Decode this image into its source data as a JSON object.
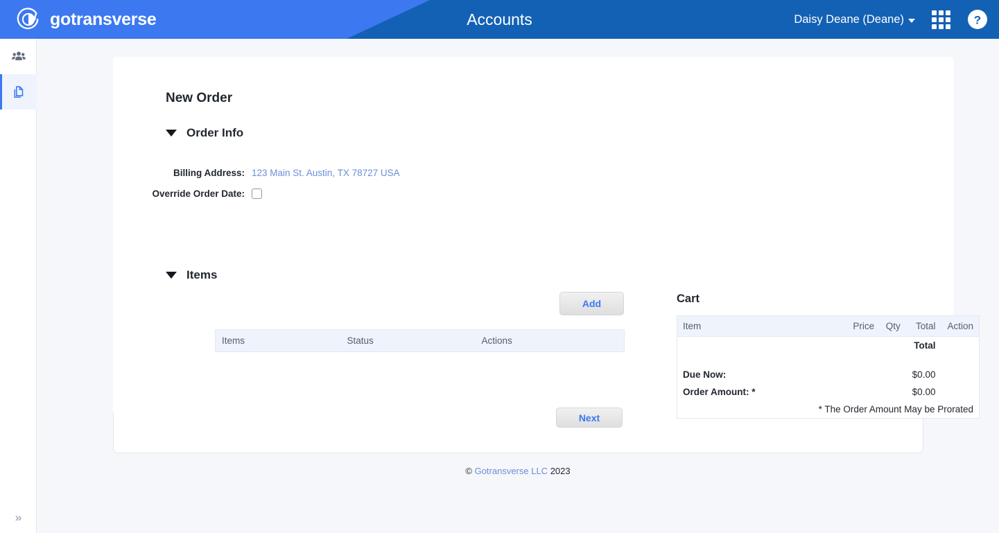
{
  "header": {
    "brand": "gotransverse",
    "brand_logo_icon": "gotransverse-circle-logo",
    "title": "Accounts",
    "user_menu": "Daisy Deane (Deane)",
    "apps_icon": "grid-apps-icon",
    "help_icon": "help-question-icon",
    "caret_icon": "chevron-down-icon",
    "wedge_color": "#3c78f0",
    "bar_color": "#1361b5"
  },
  "sidebar": {
    "items": [
      {
        "name": "customers",
        "icon": "users-group-icon",
        "active": false
      },
      {
        "name": "orders",
        "icon": "file-copy-icon",
        "active": true
      }
    ],
    "expand_icon": "double-chevron-right-icon",
    "expand_label": "»",
    "active_accent": "#3c78f0"
  },
  "main": {
    "page_heading": "New Order",
    "order_info": {
      "section_label": "Order Info",
      "collapse_icon": "triangle-down-icon",
      "fields": [
        {
          "label": "Billing Address:",
          "value": "123 Main St. Austin, TX 78727 USA",
          "type": "link"
        },
        {
          "label": "Override Order Date:",
          "value": "",
          "type": "checkbox",
          "checked": false
        }
      ]
    },
    "items_section": {
      "section_label": "Items",
      "collapse_icon": "triangle-down-icon",
      "add_label": "Add",
      "columns": [
        "Items",
        "Status",
        "Actions"
      ],
      "rows": []
    },
    "next_label": "Next",
    "cart": {
      "title": "Cart",
      "columns": [
        "Item",
        "Price",
        "Qty",
        "Total",
        "Action"
      ],
      "total_header": "Total",
      "rows": [
        {
          "label": "Due Now:",
          "value": "$0.00"
        },
        {
          "label": "Order Amount: *",
          "value": "$0.00"
        }
      ],
      "note": "* The Order Amount May be Prorated"
    }
  },
  "footer": {
    "copyright_symbol": "©",
    "company": "Gotransverse LLC",
    "year": "2023"
  }
}
